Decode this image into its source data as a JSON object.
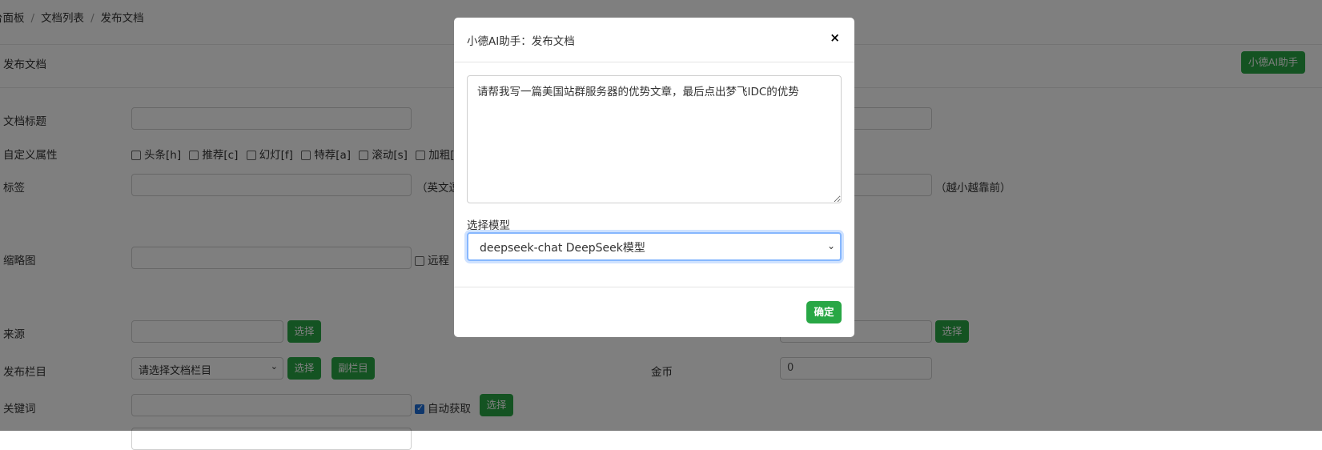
{
  "breadcrumb": {
    "items": [
      "台面板",
      "文档列表",
      "发布文档"
    ],
    "separator": "/"
  },
  "panel": {
    "title": "发布文档",
    "ai_button": "小德AI助手"
  },
  "form": {
    "doc_title_label": "文档标题",
    "custom_attr_label": "自定义属性",
    "attrs": [
      "头条[h]",
      "推荐[c]",
      "幻灯[f]",
      "特荐[a]",
      "滚动[s]",
      "加粗[b]"
    ],
    "tags_label": "标签",
    "tags_hint": "（英文逗",
    "sort_hint": "（越小越靠前）",
    "thumb_label": "缩略图",
    "remote_label": "远程",
    "source_label": "来源",
    "select_button": "选择",
    "category_label": "发布栏目",
    "category_placeholder": "请选择文档栏目",
    "subcategory_button": "副栏目",
    "coins_label": "金币",
    "coins_value": "0",
    "keywords_label": "关键词",
    "auto_fetch_label": "自动获取"
  },
  "modal": {
    "title": "小德AI助手：发布文档",
    "close_icon": "×",
    "prompt": "请帮我写一篇美国站群服务器的优势文章，最后点出梦飞IDC的优势",
    "model_label": "选择模型",
    "model_selected": "deepseek-chat DeepSeek模型",
    "ok_button": "确定"
  },
  "colors": {
    "accent_green": "#28a745",
    "focus_blue": "#86b7fe",
    "overlay": "rgba(0,0,0,0.5)"
  }
}
